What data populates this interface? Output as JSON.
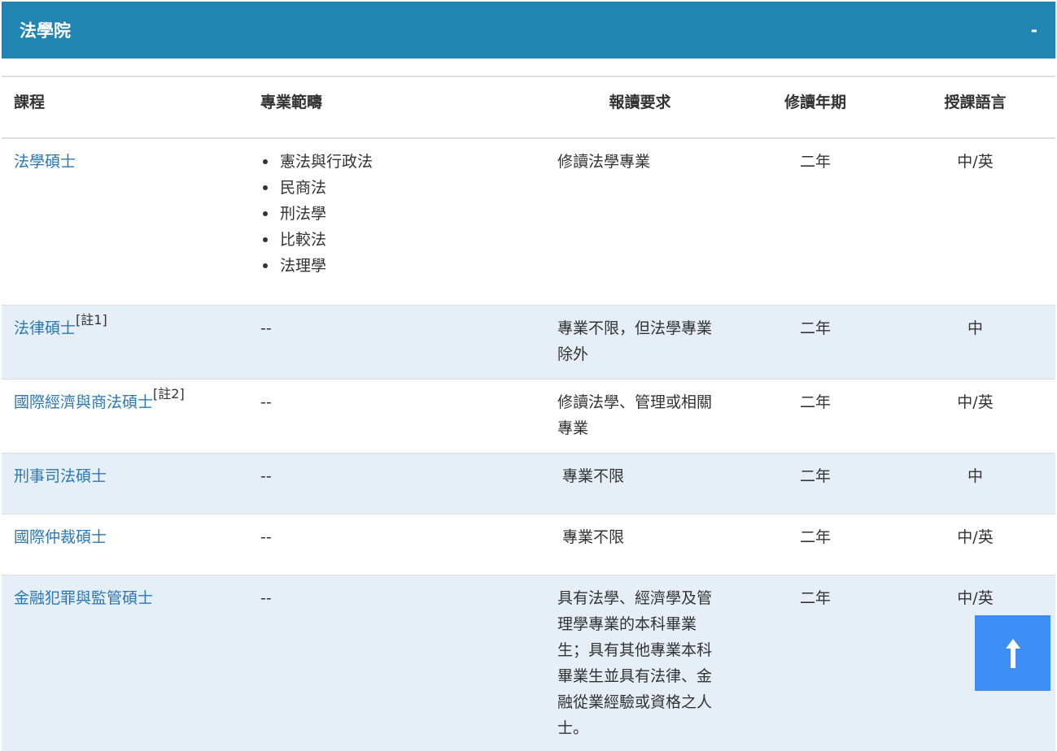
{
  "panel": {
    "title": "法學院",
    "toggle": "-"
  },
  "table": {
    "headers": {
      "course": "課程",
      "specialization": "專業範疇",
      "requirement": "報讀要求",
      "duration": "修讀年期",
      "language": "授課語言"
    },
    "rows": [
      {
        "course": "法學碩士",
        "note": "",
        "specializations": [
          "憲法與行政法",
          "民商法",
          "刑法學",
          "比較法",
          "法理學"
        ],
        "requirement": "修讀法學專業",
        "duration": "二年",
        "language": "中/英"
      },
      {
        "course": "法律碩士",
        "note": "[註1]",
        "specialization_text": "--",
        "requirement": "專業不限，但法學專業除外",
        "duration": "二年",
        "language": "中"
      },
      {
        "course": "國際經濟與商法碩士",
        "note": "[註2]",
        "specialization_text": "--",
        "requirement": "修讀法學、管理或相關專業",
        "duration": "二年",
        "language": "中/英"
      },
      {
        "course": "刑事司法碩士",
        "note": "",
        "specialization_text": "--",
        "requirement": "專業不限",
        "duration": "二年",
        "language": "中"
      },
      {
        "course": "國際仲裁碩士",
        "note": "",
        "specialization_text": "--",
        "requirement": "專業不限",
        "duration": "二年",
        "language": "中/英"
      },
      {
        "course": "金融犯罪與監管碩士",
        "note": "",
        "specialization_text": "--",
        "requirement": "具有法學、經濟學及管理學專業的本科畢業生；具有其他專業本科畢業生並具有法律、金融從業經驗或資格之人士。",
        "duration": "二年",
        "language": "中/英"
      }
    ]
  },
  "back_to_top": {
    "icon": "arrow-up-icon"
  },
  "colors": {
    "header_bg": "#2185b3",
    "link": "#2a78b5",
    "stripe": "#e6eef7",
    "back_to_top": "#3d8ff5"
  }
}
